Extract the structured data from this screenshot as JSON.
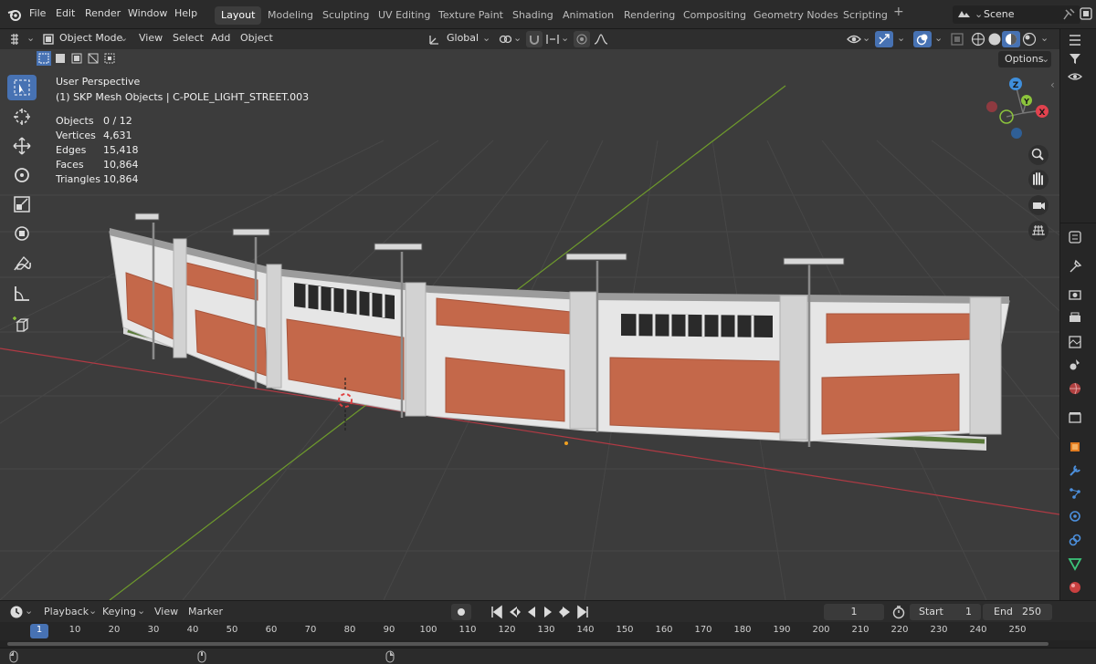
{
  "menu": {
    "items": [
      "File",
      "Edit",
      "Render",
      "Window",
      "Help"
    ]
  },
  "workspaces": [
    "Layout",
    "Modeling",
    "Sculpting",
    "UV Editing",
    "Texture Paint",
    "Shading",
    "Animation",
    "Rendering",
    "Compositing",
    "Geometry Nodes",
    "Scripting"
  ],
  "scene": {
    "name": "Scene"
  },
  "viewport_header": {
    "mode": "Object Mode",
    "menus": [
      "View",
      "Select",
      "Add",
      "Object"
    ],
    "orientation": "Global",
    "options_label": "Options"
  },
  "overlay": {
    "view_name": "User Perspective",
    "collection_info": "(1) SKP Mesh Objects | C-POLE_LIGHT_STREET.003",
    "stats": [
      {
        "label": "Objects",
        "value": "0 / 12"
      },
      {
        "label": "Vertices",
        "value": "4,631"
      },
      {
        "label": "Edges",
        "value": "15,418"
      },
      {
        "label": "Faces",
        "value": "10,864"
      },
      {
        "label": "Triangles",
        "value": "10,864"
      }
    ]
  },
  "gizmo": {
    "x": "X",
    "y": "Y",
    "z": "Z"
  },
  "timeline": {
    "menus": [
      "Playback",
      "Keying",
      "View",
      "Marker"
    ],
    "current_frame": "1",
    "start_label": "Start",
    "start_value": "1",
    "end_label": "End",
    "end_value": "250",
    "ruler": [
      "1",
      "10",
      "20",
      "30",
      "40",
      "50",
      "60",
      "70",
      "80",
      "90",
      "100",
      "110",
      "120",
      "130",
      "140",
      "150",
      "160",
      "170",
      "180",
      "190",
      "200",
      "210",
      "220",
      "230",
      "240",
      "250"
    ]
  },
  "colors": {
    "accent": "#4772b3",
    "x_axis": "#e2424e",
    "y_axis": "#8cc43c",
    "z_axis": "#3f8fdc",
    "brick": "#c4684a",
    "wall": "#e4e4e4"
  }
}
